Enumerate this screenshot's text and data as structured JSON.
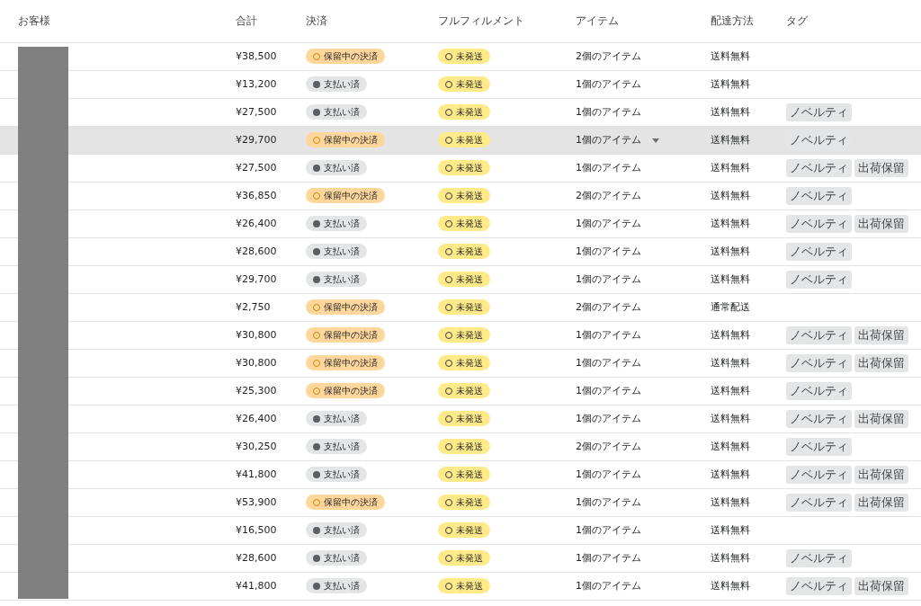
{
  "table": {
    "columns": [
      "お客様",
      "合計",
      "決済",
      "フルフィルメント",
      "アイテム",
      "配達方法",
      "タグ"
    ],
    "rows": [
      {
        "total": "¥38,500",
        "payment": {
          "kind": "pending",
          "label": "保留中の決済"
        },
        "fulfillment": "未発送",
        "items": "2個のアイテム",
        "delivery": "送料無料",
        "tags": [],
        "highlighted": false
      },
      {
        "total": "¥13,200",
        "payment": {
          "kind": "paid",
          "label": "支払い済"
        },
        "fulfillment": "未発送",
        "items": "1個のアイテム",
        "delivery": "送料無料",
        "tags": [],
        "highlighted": false
      },
      {
        "total": "¥27,500",
        "payment": {
          "kind": "paid",
          "label": "支払い済"
        },
        "fulfillment": "未発送",
        "items": "1個のアイテム",
        "delivery": "送料無料",
        "tags": [
          "ノベルティ"
        ],
        "highlighted": false
      },
      {
        "total": "¥29,700",
        "payment": {
          "kind": "pending",
          "label": "保留中の決済"
        },
        "fulfillment": "未発送",
        "items": "1個のアイテム",
        "delivery": "送料無料",
        "tags": [
          "ノベルティ"
        ],
        "highlighted": true
      },
      {
        "total": "¥27,500",
        "payment": {
          "kind": "paid",
          "label": "支払い済"
        },
        "fulfillment": "未発送",
        "items": "1個のアイテム",
        "delivery": "送料無料",
        "tags": [
          "ノベルティ",
          "出荷保留"
        ],
        "highlighted": false
      },
      {
        "total": "¥36,850",
        "payment": {
          "kind": "pending",
          "label": "保留中の決済"
        },
        "fulfillment": "未発送",
        "items": "2個のアイテム",
        "delivery": "送料無料",
        "tags": [
          "ノベルティ"
        ],
        "highlighted": false
      },
      {
        "total": "¥26,400",
        "payment": {
          "kind": "paid",
          "label": "支払い済"
        },
        "fulfillment": "未発送",
        "items": "1個のアイテム",
        "delivery": "送料無料",
        "tags": [
          "ノベルティ",
          "出荷保留"
        ],
        "highlighted": false
      },
      {
        "total": "¥28,600",
        "payment": {
          "kind": "paid",
          "label": "支払い済"
        },
        "fulfillment": "未発送",
        "items": "1個のアイテム",
        "delivery": "送料無料",
        "tags": [
          "ノベルティ"
        ],
        "highlighted": false
      },
      {
        "total": "¥29,700",
        "payment": {
          "kind": "paid",
          "label": "支払い済"
        },
        "fulfillment": "未発送",
        "items": "1個のアイテム",
        "delivery": "送料無料",
        "tags": [
          "ノベルティ"
        ],
        "highlighted": false
      },
      {
        "total": "¥2,750",
        "payment": {
          "kind": "pending",
          "label": "保留中の決済"
        },
        "fulfillment": "未発送",
        "items": "2個のアイテム",
        "delivery": "通常配送",
        "tags": [],
        "highlighted": false
      },
      {
        "total": "¥30,800",
        "payment": {
          "kind": "pending",
          "label": "保留中の決済"
        },
        "fulfillment": "未発送",
        "items": "1個のアイテム",
        "delivery": "送料無料",
        "tags": [
          "ノベルティ",
          "出荷保留"
        ],
        "highlighted": false
      },
      {
        "total": "¥30,800",
        "payment": {
          "kind": "pending",
          "label": "保留中の決済"
        },
        "fulfillment": "未発送",
        "items": "1個のアイテム",
        "delivery": "送料無料",
        "tags": [
          "ノベルティ",
          "出荷保留"
        ],
        "highlighted": false
      },
      {
        "total": "¥25,300",
        "payment": {
          "kind": "pending",
          "label": "保留中の決済"
        },
        "fulfillment": "未発送",
        "items": "1個のアイテム",
        "delivery": "送料無料",
        "tags": [
          "ノベルティ"
        ],
        "highlighted": false
      },
      {
        "total": "¥26,400",
        "payment": {
          "kind": "paid",
          "label": "支払い済"
        },
        "fulfillment": "未発送",
        "items": "1個のアイテム",
        "delivery": "送料無料",
        "tags": [
          "ノベルティ",
          "出荷保留"
        ],
        "highlighted": false
      },
      {
        "total": "¥30,250",
        "payment": {
          "kind": "paid",
          "label": "支払い済"
        },
        "fulfillment": "未発送",
        "items": "2個のアイテム",
        "delivery": "送料無料",
        "tags": [
          "ノベルティ"
        ],
        "highlighted": false
      },
      {
        "total": "¥41,800",
        "payment": {
          "kind": "paid",
          "label": "支払い済"
        },
        "fulfillment": "未発送",
        "items": "1個のアイテム",
        "delivery": "送料無料",
        "tags": [
          "ノベルティ",
          "出荷保留"
        ],
        "highlighted": false
      },
      {
        "total": "¥53,900",
        "payment": {
          "kind": "pending",
          "label": "保留中の決済"
        },
        "fulfillment": "未発送",
        "items": "1個のアイテム",
        "delivery": "送料無料",
        "tags": [
          "ノベルティ",
          "出荷保留"
        ],
        "highlighted": false
      },
      {
        "total": "¥16,500",
        "payment": {
          "kind": "paid",
          "label": "支払い済"
        },
        "fulfillment": "未発送",
        "items": "1個のアイテム",
        "delivery": "送料無料",
        "tags": [],
        "highlighted": false
      },
      {
        "total": "¥28,600",
        "payment": {
          "kind": "paid",
          "label": "支払い済"
        },
        "fulfillment": "未発送",
        "items": "1個のアイテム",
        "delivery": "送料無料",
        "tags": [
          "ノベルティ"
        ],
        "highlighted": false
      },
      {
        "total": "¥41,800",
        "payment": {
          "kind": "paid",
          "label": "支払い済"
        },
        "fulfillment": "未発送",
        "items": "1個のアイテム",
        "delivery": "送料無料",
        "tags": [
          "ノベルティ",
          "出荷保留"
        ],
        "highlighted": false
      }
    ]
  }
}
